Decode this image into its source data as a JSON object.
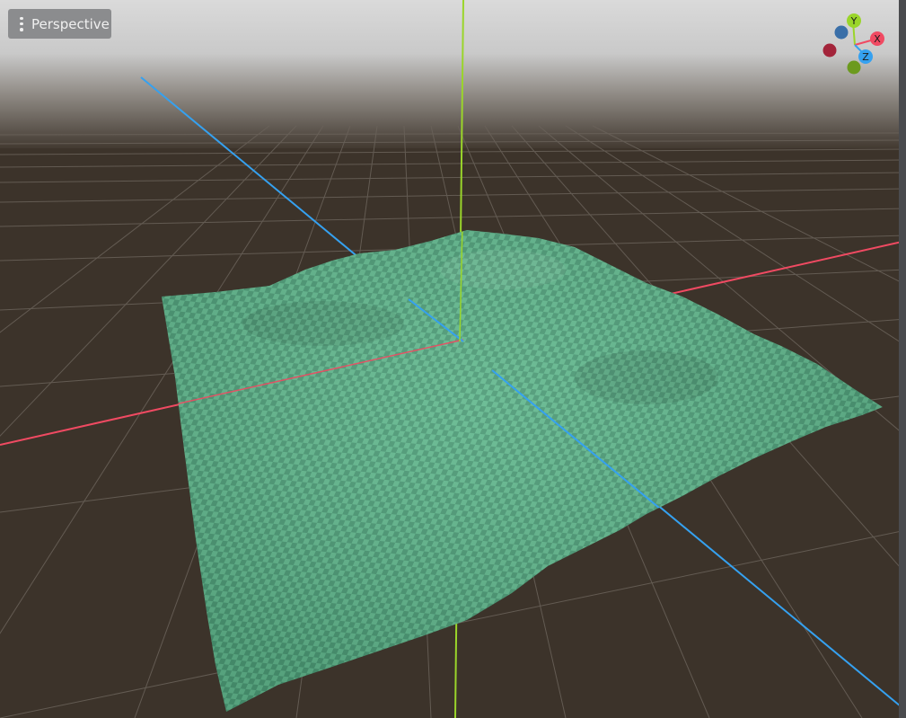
{
  "viewport": {
    "view_menu_label": "Perspective",
    "gizmo": {
      "x_label": "X",
      "y_label": "Y",
      "z_label": "Z"
    },
    "colors": {
      "x_axis": "#f04a62",
      "y_axis": "#9ad52a",
      "z_axis": "#35a1f0",
      "terrain": "#5fb48c",
      "ground": "#3c332a",
      "sky_top": "#dcdcdc"
    }
  }
}
